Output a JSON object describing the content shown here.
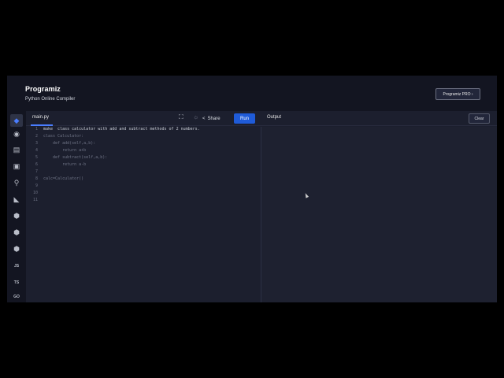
{
  "header": {
    "logo": "Programiz",
    "subtitle": "Python Online Compiler",
    "pro_button": "Programiz PRO ›"
  },
  "sidebar": {
    "icons": [
      "python-icon",
      "r-icon",
      "sql-icon",
      "html-icon",
      "java-icon",
      "kotlin-icon",
      "c-icon",
      "cpp-icon",
      "csharp-icon",
      "javascript-icon",
      "typescript-icon",
      "go-icon"
    ],
    "js_label": "JS",
    "ts_label": "TS",
    "go_label": "GO"
  },
  "toolbar": {
    "file_tab": "main.py",
    "share_label": "Share",
    "run_label": "Run",
    "output_title": "Output",
    "clear_label": "Clear"
  },
  "editor": {
    "line_numbers": [
      "1",
      "2",
      "3",
      "4",
      "5",
      "6",
      "7",
      "8",
      "9",
      "10",
      "11"
    ],
    "lines": [
      "make  class calculator with add and subtract methods of 2 numbers.",
      "class Calculator:",
      "    def add(self,a,b):",
      "        return a+b",
      "    def subtract(self,a,b):",
      "        return a-b",
      "",
      "calc=Calculator()",
      "",
      "",
      ""
    ]
  },
  "colors": {
    "accent": "#1f5bd8",
    "background": "#1c1f2e",
    "header_background": "#131521"
  }
}
